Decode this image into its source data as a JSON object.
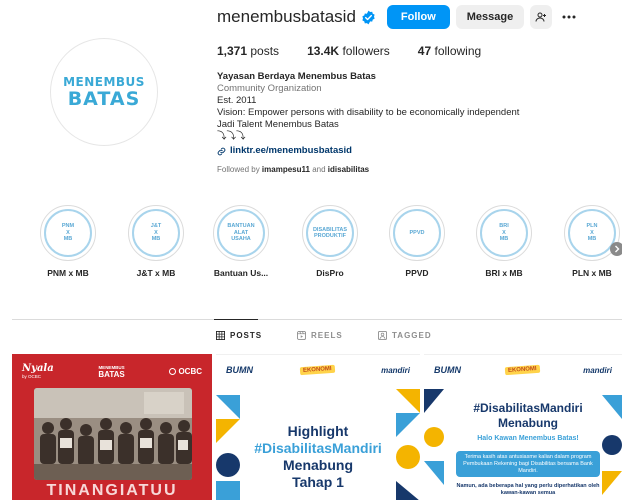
{
  "profile": {
    "username": "menembusbatasid",
    "avatar_line1": "MENEMBUS",
    "avatar_line2": "BATAS",
    "follow_label": "Follow",
    "message_label": "Message",
    "stats": {
      "posts_count": "1,371",
      "posts_label": "posts",
      "followers_count": "13.4K",
      "followers_label": "followers",
      "following_count": "47",
      "following_label": "following"
    },
    "bio": {
      "name": "Yayasan Berdaya Menembus Batas",
      "category": "Community Organization",
      "est": "Est. 2011",
      "vision": "Vision: Empower persons with disability to be economically independent",
      "tagline": "Jadi Talent Menembus Batas",
      "arrows": "⤵⤵⤵",
      "link": "linktr.ee/menembusbatasid"
    },
    "followed_by": {
      "prefix": "Followed by",
      "user1": "imampesu11",
      "joiner": "and",
      "user2": "idisabilitas"
    }
  },
  "highlights": [
    {
      "label": "PNM x MB",
      "cover": "PNM\nX\nMB"
    },
    {
      "label": "J&T x MB",
      "cover": "J&T\nX\nMB"
    },
    {
      "label": "Bantuan Us...",
      "cover": "BANTUAN\nALAT\nUSAHA"
    },
    {
      "label": "DisPro",
      "cover": "DISABILITAS\nPRODUKTIF"
    },
    {
      "label": "PPVD",
      "cover": "PPVD"
    },
    {
      "label": "BRI x MB",
      "cover": "BRI\nX\nMB"
    },
    {
      "label": "PLN x MB",
      "cover": "PLN\nX\nMB"
    }
  ],
  "tabs": {
    "posts": "POSTS",
    "reels": "REELS",
    "tagged": "TAGGED"
  },
  "posts": {
    "p1": {
      "brand": "Nyala",
      "brand_sub": "by OCBC",
      "mb_line1": "MENEMBUS",
      "mb_line2": "BATAS",
      "ocbc": "OCBC",
      "bottom_text": "TINANGIATUU"
    },
    "logos": {
      "bumn": "BUMN",
      "ekonomi": "EKONOMI",
      "mandiri": "mandiri"
    },
    "p2": {
      "line1": "Highlight",
      "line2": "#DisabilitasMandiri",
      "line3": "Menabung",
      "line4": "Tahap 1"
    },
    "p3": {
      "title1": "#DisabilitasMandiri",
      "title2": "Menabung",
      "subtitle": "Halo Kawan Menembus Batas!",
      "box": "Terima kasih atas antusiasme kalian dalam program Pembukaan Rekening bagi Disabilitas bersama Bank Mandiri.",
      "foot": "Namun, ada beberapa hal yang perlu diperhatikan oleh kawan-kawan semua"
    }
  },
  "colors": {
    "accent": "#0095f6",
    "brand_blue": "#3aa9d6",
    "post_red": "#c8262b",
    "navy": "#17386b"
  },
  "icons": {
    "verified": "verified-badge-icon",
    "add_user": "add-user-icon",
    "more": "more-horizontal-icon",
    "link": "link-icon",
    "grid": "grid-icon",
    "reels": "reels-icon",
    "tagged": "tagged-icon",
    "next": "chevron-right-icon"
  }
}
